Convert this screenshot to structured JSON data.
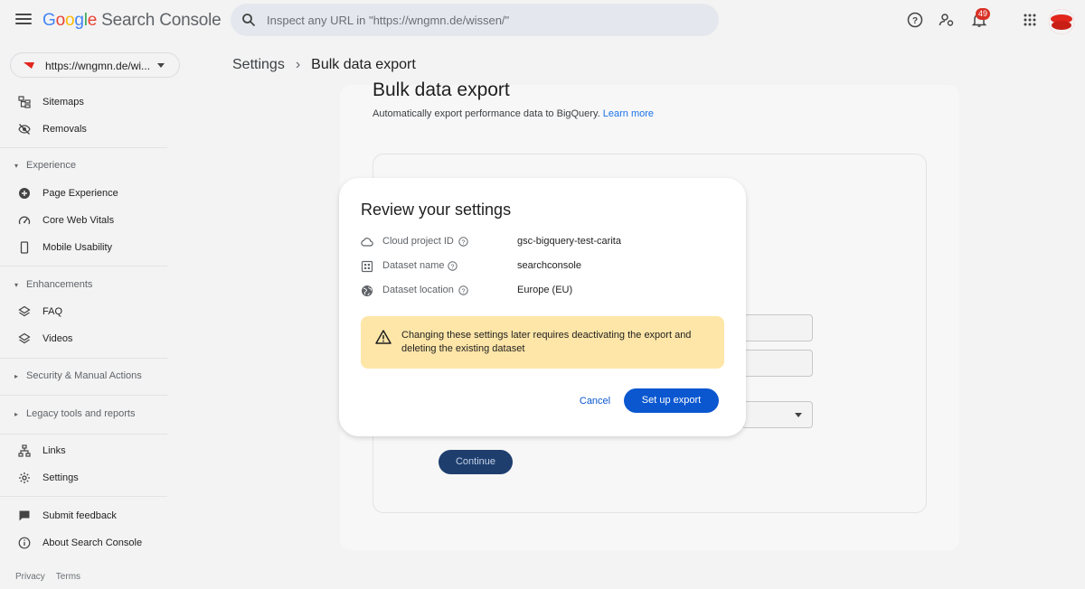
{
  "header": {
    "logo_google": [
      "G",
      "o",
      "o",
      "g",
      "l",
      "e"
    ],
    "logo_product": "Search Console",
    "search_placeholder": "Inspect any URL in \"https://wngmn.de/wissen/\"",
    "notification_count": "49"
  },
  "property": {
    "label": "https://wngmn.de/wi..."
  },
  "breadcrumb": {
    "parent": "Settings",
    "separator": "›",
    "current": "Bulk data export"
  },
  "sidebar": {
    "top_items": [
      {
        "label": "Sitemaps",
        "icon": "sitemap-icon"
      },
      {
        "label": "Removals",
        "icon": "visibility-off-icon"
      }
    ],
    "experience": {
      "label": "Experience",
      "items": [
        {
          "label": "Page Experience",
          "icon": "add-circle-icon"
        },
        {
          "label": "Core Web Vitals",
          "icon": "speed-icon"
        },
        {
          "label": "Mobile Usability",
          "icon": "smartphone-icon"
        }
      ]
    },
    "enhancements": {
      "label": "Enhancements",
      "items": [
        {
          "label": "FAQ",
          "icon": "layers-icon"
        },
        {
          "label": "Videos",
          "icon": "layers-icon"
        }
      ]
    },
    "security_label": "Security & Manual Actions",
    "legacy_label": "Legacy tools and reports",
    "bottom_items": [
      {
        "label": "Links",
        "icon": "links-icon"
      },
      {
        "label": "Settings",
        "icon": "gear-icon"
      }
    ],
    "support_items": [
      {
        "label": "Submit feedback",
        "icon": "feedback-icon"
      },
      {
        "label": "About Search Console",
        "icon": "info-icon"
      }
    ],
    "footer": {
      "privacy": "Privacy",
      "terms": "Terms"
    }
  },
  "main": {
    "title": "Bulk data export",
    "subtitle": "Automatically export performance data to BigQuery.",
    "learn_more": "Learn more",
    "continue_label": "Continue"
  },
  "dialog": {
    "title": "Review your settings",
    "rows": [
      {
        "icon": "cloud-icon",
        "label": "Cloud project ID",
        "value": "gsc-bigquery-test-carita"
      },
      {
        "icon": "dataset-icon",
        "label": "Dataset name",
        "value": "searchconsole"
      },
      {
        "icon": "globe-icon",
        "label": "Dataset location",
        "value": "Europe (EU)"
      }
    ],
    "warning": "Changing these settings later requires deactivating the export and deleting the existing dataset",
    "cancel_label": "Cancel",
    "confirm_label": "Set up export"
  },
  "colors": {
    "accent": "#0b57d0",
    "warning_bg": "#fee6a8",
    "badge": "#d93025"
  }
}
